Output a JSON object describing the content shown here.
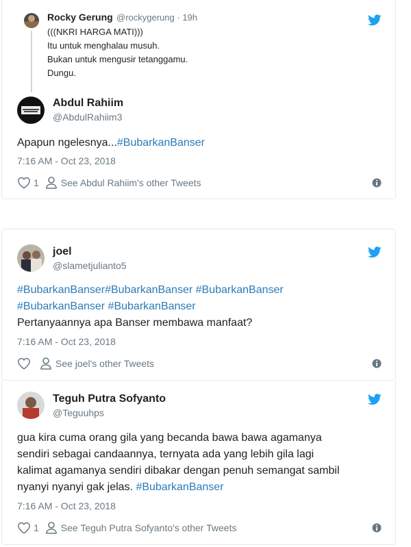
{
  "colors": {
    "link": "#2b7bb9",
    "muted": "#697882",
    "twitter_blue": "#1da1f2",
    "border": "#e1e8ed"
  },
  "tweets": [
    {
      "quoted": {
        "name": "Rocky Gerung",
        "handle": "@rockygerung",
        "time": "· 19h",
        "lines": [
          "(((NKRI HARGA MATI)))",
          "Itu untuk menghalau musuh.",
          "Bukan untuk mengusir tetanggamu.",
          "Dungu."
        ]
      },
      "name": "Abdul Rahiim",
      "handle": "@AbdulRahiim3",
      "text_plain": "Apapun ngelesnya...",
      "hashtags": [
        "#BubarkanBanser"
      ],
      "timestamp": "7:16 AM - Oct 23, 2018",
      "likes": "1",
      "see_other": "See Abdul Rahiim's other Tweets",
      "icons": [
        "heart-icon",
        "person-icon",
        "info-icon",
        "twitter-bird-icon"
      ]
    },
    {
      "name": "joel",
      "handle": "@slametjulianto5",
      "hashtags": [
        "#BubarkanBanser",
        "#BubarkanBanser",
        "#BubarkanBanser",
        "#BubarkanBanser",
        "#BubarkanBanser"
      ],
      "line3": "Pertanyaannya apa Banser membawa manfaat?",
      "timestamp": "7:16 AM - Oct 23, 2018",
      "likes": "",
      "see_other": "See joel's other Tweets",
      "icons": [
        "heart-icon",
        "person-icon",
        "info-icon",
        "twitter-bird-icon"
      ]
    },
    {
      "name": "Teguh Putra Sofyanto",
      "handle": "@Teguuhps",
      "lines": [
        "gua kira cuma orang gila yang becanda bawa bawa agamanya",
        "sendiri sebagai candaannya, ternyata ada yang lebih gila lagi",
        "kalimat agamanya sendiri dibakar dengan penuh semangat sambil",
        "nyanyi nyanyi gak jelas. "
      ],
      "hashtags": [
        "#BubarkanBanser"
      ],
      "timestamp": "7:16 AM - Oct 23, 2018",
      "likes": "1",
      "see_other": "See Teguh Putra Sofyanto's other Tweets",
      "icons": [
        "heart-icon",
        "person-icon",
        "info-icon",
        "twitter-bird-icon"
      ]
    }
  ]
}
